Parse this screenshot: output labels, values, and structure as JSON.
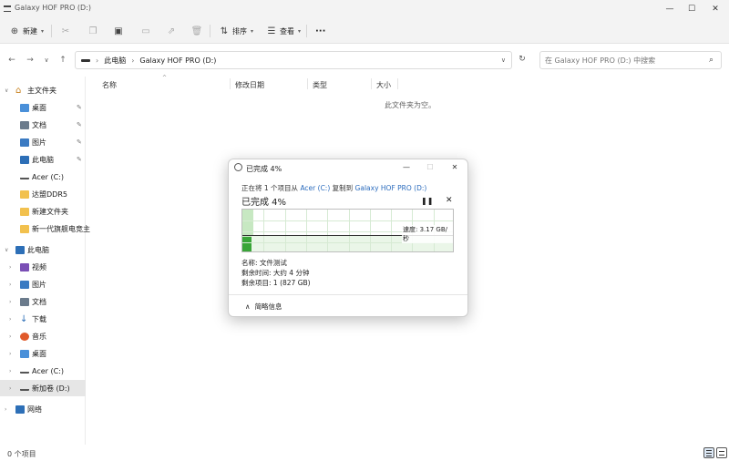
{
  "window": {
    "title": "Galaxy HOF PRO (D:)",
    "controls": {
      "minimize": "—",
      "maximize": "☐",
      "close": "✕"
    }
  },
  "toolbar": {
    "new_label": "新建",
    "sort_label": "排序",
    "view_label": "查看",
    "more": "···"
  },
  "address": {
    "segments": [
      "此电脑",
      "Galaxy HOF PRO (D:)"
    ],
    "search_placeholder": "在 Galaxy HOF PRO (D:) 中搜索"
  },
  "sidebar": {
    "quick_access": "主文件夹",
    "pinned": [
      "桌面",
      "文档",
      "图片",
      "此电脑"
    ],
    "recent": [
      "Acer (C:)",
      "达盟DDR5",
      "新建文件夹",
      "新一代旗舰电竞主"
    ],
    "this_pc": "此电脑",
    "this_pc_items": [
      "视频",
      "图片",
      "文档",
      "下载",
      "音乐",
      "桌面",
      "Acer (C:)",
      "新加卷 (D:)"
    ],
    "network": "网络"
  },
  "columns": {
    "name": "名称",
    "modified": "修改日期",
    "type": "类型",
    "size": "大小"
  },
  "main": {
    "empty_message": "此文件夹为空。"
  },
  "status": {
    "count": "0 个项目"
  },
  "copy_dialog": {
    "title": "已完成 4%",
    "from_prefix": "正在将 1 个项目从",
    "source": "Acer (C:)",
    "middle": "复制到",
    "destination": "Galaxy HOF PRO (D:)",
    "percent_label": "已完成 4%",
    "progress": 0.04,
    "speed": "速度: 3.17 GB/秒",
    "name_line": "名称: 文件测试",
    "time_left": "剩余时间: 大约 4 分钟",
    "items_left": "剩余项目: 1 (827 GB)",
    "less_details": "简略信息",
    "pause_icon": "pause-icon",
    "close_icon": "close-icon"
  }
}
